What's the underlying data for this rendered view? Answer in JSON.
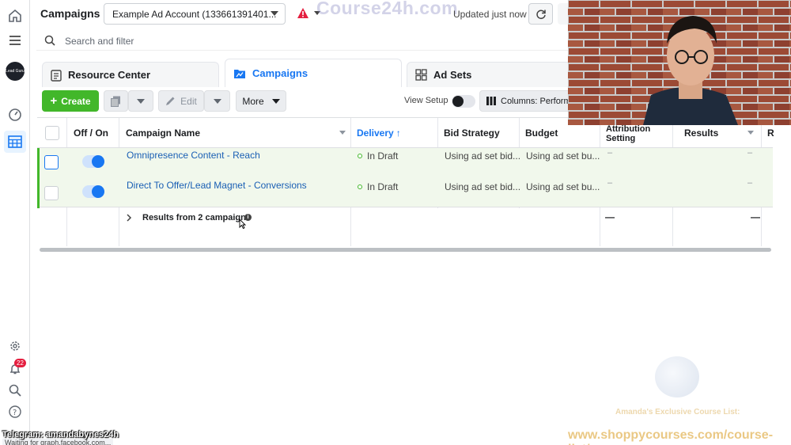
{
  "app": {
    "page_title": "Campaigns",
    "account_selector": "Example Ad Account (133661391401...",
    "updated_status": "Updated just now",
    "watermark": "Course24h.com"
  },
  "rail": {
    "avatar_text": "Lead Guru",
    "notification_count": "22"
  },
  "search": {
    "placeholder": "Search and filter"
  },
  "tabs": [
    {
      "label": "Resource Center"
    },
    {
      "label": "Campaigns"
    },
    {
      "label": "Ad Sets"
    }
  ],
  "toolbar": {
    "create_label": "Create",
    "edit_label": "Edit",
    "more_label": "More",
    "view_setup_label": "View Setup",
    "columns_label": "Columns: Perform"
  },
  "table": {
    "headers": {
      "off_on": "Off / On",
      "campaign_name": "Campaign Name",
      "delivery": "Delivery",
      "bid_strategy": "Bid Strategy",
      "budget": "Budget",
      "attribution": "Attribution Setting",
      "results": "Results",
      "r": "R"
    },
    "rows": [
      {
        "name": "Omnipresence Content - Reach",
        "delivery": "In Draft",
        "bid_strategy": "Using ad set bid...",
        "budget": "Using ad set bu...",
        "attribution": "–",
        "results": "–"
      },
      {
        "name": "Direct To Offer/Lead Magnet - Conversions",
        "delivery": "In Draft",
        "bid_strategy": "Using ad set bid...",
        "budget": "Using ad set bu...",
        "attribution": "–",
        "results": "–"
      }
    ],
    "summary": {
      "label": "Results from 2 campaigns",
      "attribution": "—",
      "results": "—"
    }
  },
  "overlays": {
    "telegram": "Telegram: amandabynes24h",
    "status_bar": "Waiting for graph.facebook.com...",
    "promo_title": "Amanda's Exclusive Course List:",
    "promo_url": "www.shoppycourses.com/course-list/"
  }
}
